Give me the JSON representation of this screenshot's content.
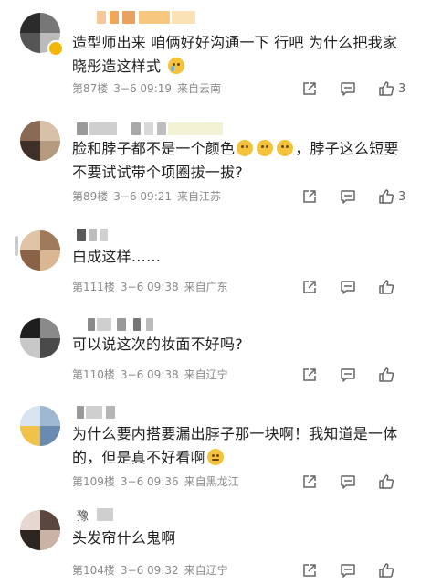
{
  "comments": [
    {
      "text_line1": "造型师出来 咱俩好好沟通一下 行吧 为什么把我家",
      "text_line2": "晓彤造这样式",
      "floor": "第87楼",
      "time": "3−6 09:19",
      "location": "来自云南",
      "likes": "3"
    },
    {
      "text_line1": "脸和脖子都不是一个颜色",
      "text_line1_after": "，脖子这么短要",
      "text_line2": "不要试试带个项圈拔一拔?",
      "floor": "第89楼",
      "time": "3−6 09:21",
      "location": "来自江苏",
      "likes": "3"
    },
    {
      "text_line1": "白成这样……",
      "floor": "第111楼",
      "time": "3−6 09:38",
      "location": "来自广东",
      "likes": ""
    },
    {
      "text_line1": "可以说这次的妆面不好吗?",
      "floor": "第110楼",
      "time": "3−6 09:38",
      "location": "来自辽宁",
      "likes": ""
    },
    {
      "text_line1": "为什么要内搭要漏出脖子那一块啊！我知道是一体",
      "text_line2": "的，但是真不好看啊",
      "floor": "第109楼",
      "time": "3−6 09:36",
      "location": "来自黑龙江",
      "likes": ""
    },
    {
      "name_char": "豫",
      "text_line1": "头发帘什么鬼啊",
      "floor": "第104楼",
      "time": "3−6 09:32",
      "location": "来自辽宁",
      "likes": ""
    }
  ],
  "icons": {
    "share": "share-icon",
    "comment": "comment-icon",
    "like": "thumbs-up-icon",
    "emoji_cry": "crying-face-emoji",
    "emoji_cold_sweat": "cold-sweat-face-emoji",
    "emoji_smirk": "smirk-face-emoji"
  },
  "colors": {
    "meta_text": "#8a8a8a",
    "body_text": "#1f1f1f",
    "icon": "#666666",
    "vip_badge": "#f2b705"
  }
}
